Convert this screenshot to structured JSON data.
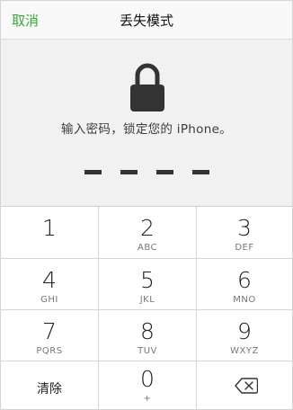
{
  "nav": {
    "cancel_label": "取消",
    "title": "丢失模式"
  },
  "lock_screen": {
    "icon": "lock-icon",
    "prompt": "输入密码，锁定您的 iPhone。",
    "passcode_length": 4,
    "digits_entered": 0
  },
  "keypad": {
    "keys": [
      {
        "num": "1",
        "letters": ""
      },
      {
        "num": "2",
        "letters": "ABC"
      },
      {
        "num": "3",
        "letters": "DEF"
      },
      {
        "num": "4",
        "letters": "GHI"
      },
      {
        "num": "5",
        "letters": "JKL"
      },
      {
        "num": "6",
        "letters": "MNO"
      },
      {
        "num": "7",
        "letters": "PQRS"
      },
      {
        "num": "8",
        "letters": "TUV"
      },
      {
        "num": "9",
        "letters": "WXYZ"
      }
    ],
    "clear_label": "清除",
    "zero": {
      "num": "0",
      "letters": "+"
    },
    "backspace_icon": "backspace-icon"
  },
  "colors": {
    "accent": "#3aa63a",
    "background": "#f1f1f1",
    "keypad_background": "#ffffff",
    "lock": "#333333"
  }
}
